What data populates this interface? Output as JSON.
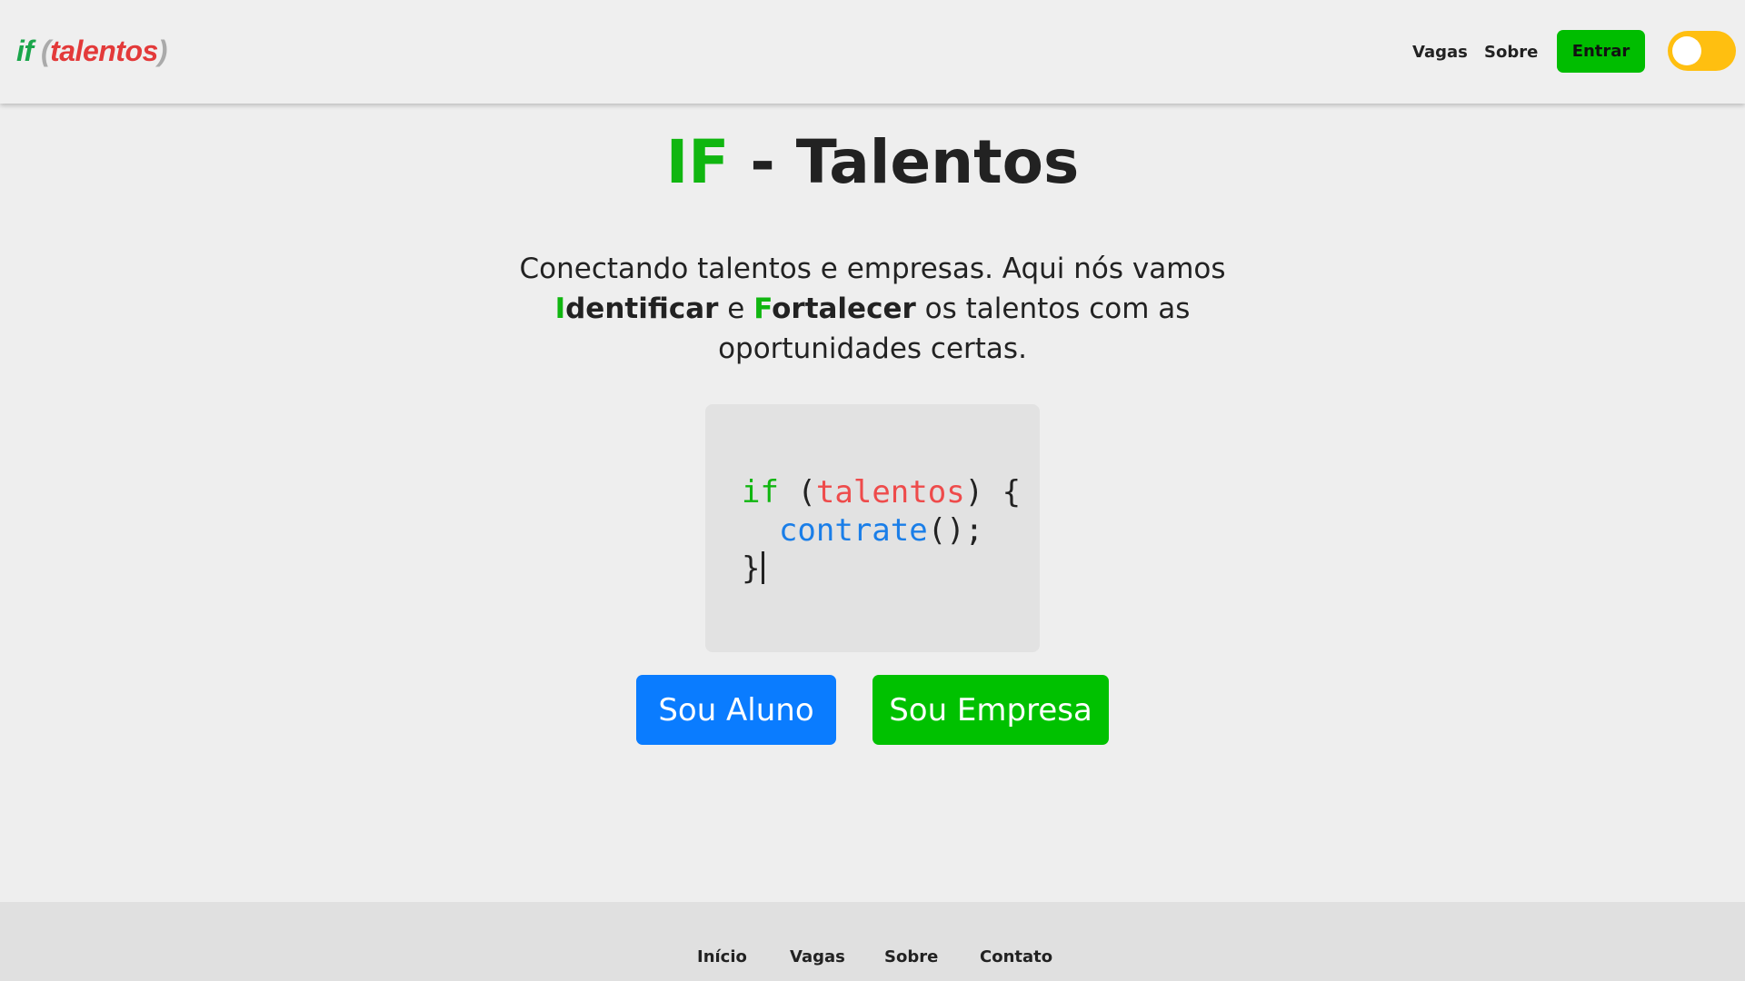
{
  "header": {
    "logo": {
      "keyword": "if",
      "open_paren": "(",
      "word": "talentos",
      "close_paren": ")"
    },
    "nav": [
      {
        "label": "Vagas"
      },
      {
        "label": "Sobre"
      }
    ],
    "login_label": "Entrar",
    "theme_toggle": {
      "state": "off",
      "color": "#ffbf10"
    }
  },
  "hero": {
    "title_accent": "IF",
    "title_rest": " - Talentos",
    "text_part1": "Conectando talentos e empresas. Aqui nós vamos ",
    "identify_initial": "I",
    "identify_rest": "dentificar",
    "conj": " e ",
    "strengthen_initial": "F",
    "strengthen_rest": "ortalecer",
    "text_part2": " os talentos com as oportunidades certas."
  },
  "code": {
    "keyword": "if",
    "open": " (",
    "variable": "talentos",
    "close": ") {",
    "indent": "  ",
    "function": "contrate",
    "call": "();",
    "end": "}"
  },
  "buttons": {
    "student": "Sou Aluno",
    "company": "Sou Empresa"
  },
  "footer": {
    "links": [
      {
        "label": "Início"
      },
      {
        "label": "Vagas"
      },
      {
        "label": "Sobre"
      },
      {
        "label": "Contato"
      }
    ]
  },
  "colors": {
    "accent_green": "#10b610",
    "primary_blue": "#0a7cff",
    "button_green": "#00c100",
    "logo_red": "#e33a3a",
    "toggle_yellow": "#ffbf10"
  }
}
